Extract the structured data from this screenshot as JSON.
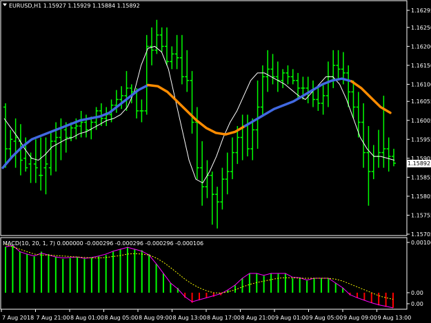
{
  "main": {
    "title": "EURUSD,H1  1.15927 1.15929 1.15884 1.15892",
    "price_ticks": [
      "1.16295",
      "1.16250",
      "1.16200",
      "1.16150",
      "1.16100",
      "1.16055",
      "1.16005",
      "1.15955",
      "1.15905",
      "1.15855",
      "1.15805",
      "1.15755",
      "1.15705"
    ],
    "current_price": "1.15892"
  },
  "macd": {
    "title": "MACD(10, 20, 1, 7) 0.000000 -0.000296 -0.000296 -0.000296 -0.000106",
    "ticks": [
      "0.001068",
      "0.00",
      "0.00"
    ]
  },
  "time_labels": [
    "7 Aug 2018",
    "7 Aug 21:00",
    "8 Aug 01:00",
    "8 Aug 05:00",
    "8 Aug 09:00",
    "8 Aug 13:00",
    "8 Aug 17:00",
    "8 Aug 21:00",
    "9 Aug 01:00",
    "9 Aug 05:00",
    "9 Aug 09:00",
    "9 Aug 13:00"
  ],
  "colors": {
    "bars": "#00ff00",
    "fast_ma": "#ffffff",
    "slow_ma_up": "#4169e1",
    "slow_ma_down": "#ff8c00",
    "macd_hist_up": "#00ff00",
    "macd_hist_dn": "#ff0000",
    "macd_line": "#ff00ff",
    "signal_line": "#ffff00"
  },
  "chart_data": {
    "type": "ohlc",
    "price_range": [
      1.15705,
      1.16315
    ],
    "bars": [
      [
        1.1604,
        1.1605,
        1.1588,
        1.1593
      ],
      [
        1.1593,
        1.1598,
        1.15905,
        1.15955
      ],
      [
        1.1595,
        1.1601,
        1.1588,
        1.1596
      ],
      [
        1.1595,
        1.15995,
        1.1586,
        1.159
      ],
      [
        1.15905,
        1.1596,
        1.1587,
        1.1588
      ],
      [
        1.1589,
        1.1592,
        1.1584,
        1.15905
      ],
      [
        1.1589,
        1.15955,
        1.1584,
        1.1588
      ],
      [
        1.1586,
        1.1596,
        1.1582,
        1.1586
      ],
      [
        1.1588,
        1.1596,
        1.1581,
        1.1589
      ],
      [
        1.1588,
        1.15975,
        1.1586,
        1.1595
      ],
      [
        1.1595,
        1.16,
        1.1587,
        1.1596
      ],
      [
        1.1596,
        1.1601,
        1.159,
        1.15985
      ],
      [
        1.1598,
        1.16,
        1.1592,
        1.1596
      ],
      [
        1.1596,
        1.16,
        1.1595,
        1.15985
      ],
      [
        1.15985,
        1.1601,
        1.15955,
        1.1599
      ],
      [
        1.1599,
        1.1603,
        1.1596,
        1.16
      ],
      [
        1.16,
        1.1602,
        1.1596,
        1.1598
      ],
      [
        1.1598,
        1.16015,
        1.15955,
        1.16
      ],
      [
        1.16,
        1.1604,
        1.1598,
        1.1603
      ],
      [
        1.1603,
        1.1605,
        1.1599,
        1.1601
      ],
      [
        1.1601,
        1.1604,
        1.1599,
        1.1602
      ],
      [
        1.1602,
        1.1606,
        1.16,
        1.16045
      ],
      [
        1.16045,
        1.16085,
        1.16025,
        1.1606
      ],
      [
        1.1606,
        1.16095,
        1.16035,
        1.1607
      ],
      [
        1.1607,
        1.16135,
        1.1603,
        1.1609
      ],
      [
        1.1609,
        1.161,
        1.1605,
        1.1608
      ],
      [
        1.1608,
        1.1609,
        1.1601,
        1.1603
      ],
      [
        1.1603,
        1.1606,
        1.16,
        1.1603
      ],
      [
        1.1603,
        1.1623,
        1.1602,
        1.162
      ],
      [
        1.162,
        1.1625,
        1.1615,
        1.1619
      ],
      [
        1.1619,
        1.1627,
        1.1618,
        1.1623
      ],
      [
        1.1623,
        1.1625,
        1.16185,
        1.162
      ],
      [
        1.162,
        1.1625,
        1.1615,
        1.1616
      ],
      [
        1.1616,
        1.162,
        1.1614,
        1.1618
      ],
      [
        1.1618,
        1.1623,
        1.1614,
        1.1617
      ],
      [
        1.1617,
        1.1623,
        1.161,
        1.1612
      ],
      [
        1.1612,
        1.1619,
        1.1608,
        1.1611
      ],
      [
        1.1611,
        1.16135,
        1.1597,
        1.16
      ],
      [
        1.16,
        1.1604,
        1.1585,
        1.1588
      ],
      [
        1.1588,
        1.1595,
        1.1578,
        1.1583
      ],
      [
        1.1583,
        1.159,
        1.158,
        1.1586
      ],
      [
        1.1586,
        1.1587,
        1.1573,
        1.1581
      ],
      [
        1.1581,
        1.1583,
        1.1572,
        1.1579
      ],
      [
        1.1579,
        1.1588,
        1.1577,
        1.1585
      ],
      [
        1.1585,
        1.1592,
        1.1581,
        1.1587
      ],
      [
        1.1587,
        1.1596,
        1.1585,
        1.1592
      ],
      [
        1.1592,
        1.1599,
        1.1589,
        1.1596
      ],
      [
        1.1596,
        1.1602,
        1.159,
        1.1599
      ],
      [
        1.1599,
        1.1602,
        1.1591,
        1.1593
      ],
      [
        1.1593,
        1.1601,
        1.159,
        1.1598
      ],
      [
        1.1598,
        1.1611,
        1.1593,
        1.1604
      ],
      [
        1.1604,
        1.1615,
        1.1602,
        1.1612
      ],
      [
        1.1612,
        1.1619,
        1.1608,
        1.1614
      ],
      [
        1.1614,
        1.1618,
        1.161,
        1.1612
      ],
      [
        1.1612,
        1.1616,
        1.1608,
        1.1611
      ],
      [
        1.1611,
        1.1614,
        1.1609,
        1.1613
      ],
      [
        1.1613,
        1.1615,
        1.161,
        1.1612
      ],
      [
        1.1612,
        1.1614,
        1.161,
        1.1611
      ],
      [
        1.1611,
        1.1613,
        1.1606,
        1.1609
      ],
      [
        1.1609,
        1.1612,
        1.1606,
        1.1609
      ],
      [
        1.1609,
        1.1612,
        1.1605,
        1.1608
      ],
      [
        1.1608,
        1.1611,
        1.1604,
        1.1606
      ],
      [
        1.1606,
        1.1609,
        1.1603,
        1.1605
      ],
      [
        1.1605,
        1.161,
        1.1602,
        1.1607
      ],
      [
        1.1607,
        1.1616,
        1.1604,
        1.1612
      ],
      [
        1.1612,
        1.1619,
        1.1609,
        1.1615
      ],
      [
        1.1615,
        1.1619,
        1.1611,
        1.1614
      ],
      [
        1.1614,
        1.16185,
        1.161,
        1.1613
      ],
      [
        1.1613,
        1.1615,
        1.1604,
        1.1608
      ],
      [
        1.1608,
        1.1611,
        1.1601,
        1.1604
      ],
      [
        1.1604,
        1.1608,
        1.1596,
        1.16
      ],
      [
        1.16,
        1.1605,
        1.1588,
        1.1592
      ],
      [
        1.1592,
        1.1599,
        1.1578,
        1.1587
      ],
      [
        1.1587,
        1.1594,
        1.1585,
        1.1591
      ],
      [
        1.1591,
        1.1598,
        1.1588,
        1.1592
      ],
      [
        1.1592,
        1.1607,
        1.1588,
        1.1593
      ],
      [
        1.1593,
        1.1596,
        1.1587,
        1.1591
      ],
      [
        1.1591,
        1.1593,
        1.15884,
        1.15892
      ]
    ],
    "fast_ma": [
      1.1601,
      1.15985,
      1.1596,
      1.1593,
      1.15905,
      1.159,
      1.15915,
      1.15935,
      1.15945,
      1.15955,
      1.1596,
      1.1597,
      1.15975,
      1.15985,
      1.15995,
      1.16005,
      1.1601,
      1.1602,
      1.1604,
      1.1608,
      1.1615,
      1.16195,
      1.162,
      1.16185,
      1.1614,
      1.1606,
      1.1598,
      1.159,
      1.1585,
      1.1584,
      1.1587,
      1.1591,
      1.1596,
      1.16,
      1.1603,
      1.1607,
      1.1611,
      1.1613,
      1.1613,
      1.1612,
      1.1611,
      1.161,
      1.16085,
      1.1607,
      1.1606,
      1.1608,
      1.161,
      1.1612,
      1.1612,
      1.161,
      1.1606,
      1.1601,
      1.1596,
      1.1593,
      1.1591,
      1.1591,
      1.15905,
      1.159
    ],
    "slow_ma": [
      1.1588,
      1.1591,
      1.15935,
      1.15955,
      1.15965,
      1.15975,
      1.15985,
      1.15995,
      1.16005,
      1.1601,
      1.16015,
      1.16025,
      1.16045,
      1.16065,
      1.16085,
      1.16098,
      1.16095,
      1.1608,
      1.16055,
      1.1603,
      1.16005,
      1.15985,
      1.15972,
      1.15968,
      1.15975,
      1.1599,
      1.16005,
      1.1602,
      1.16035,
      1.16045,
      1.16055,
      1.1607,
      1.16085,
      1.161,
      1.1611,
      1.16115,
      1.16108,
      1.1609,
      1.16065,
      1.1604,
      1.16025
    ],
    "slow_ma_turns": [
      15,
      25,
      36
    ],
    "macd_range": [
      -0.0003,
      0.00107
    ],
    "macd_hist": [
      0.00095,
      0.001,
      0.00085,
      0.0008,
      0.00075,
      0.00085,
      0.0008,
      0.00075,
      0.0007,
      0.00072,
      0.00074,
      0.0007,
      0.00072,
      0.00075,
      0.00078,
      0.00085,
      0.0009,
      0.00095,
      0.0009,
      0.00088,
      0.0008,
      0.0006,
      0.0004,
      0.0002,
      0.0001,
      -0.0001,
      -0.0002,
      -0.00015,
      -0.0001,
      -8e-05,
      -5e-05,
      5e-05,
      0.00015,
      0.0003,
      0.0004,
      0.0004,
      0.00035,
      0.0004,
      0.0004,
      0.0004,
      0.0003,
      0.0003,
      0.00025,
      0.0003,
      0.0003,
      0.0003,
      0.0002,
      0.0001,
      -5e-05,
      -0.0001,
      -0.00015,
      -0.0002,
      -0.00025,
      -0.00028,
      -0.0003
    ],
    "macd_line": [
      0.00095,
      0.00098,
      0.00085,
      0.0008,
      0.00076,
      0.00082,
      0.00078,
      0.00074,
      0.00072,
      0.00073,
      0.00074,
      0.00071,
      0.00073,
      0.00076,
      0.0008,
      0.00086,
      0.0009,
      0.00094,
      0.0009,
      0.00086,
      0.00078,
      0.0006,
      0.0004,
      0.0002,
      8e-05,
      -8e-05,
      -0.00018,
      -0.00014,
      -0.0001,
      -6e-05,
      -2e-05,
      6e-05,
      0.00016,
      0.0003,
      0.0004,
      0.0004,
      0.00036,
      0.0004,
      0.0004,
      0.0004,
      0.00032,
      0.00031,
      0.00026,
      0.0003,
      0.0003,
      0.0003,
      0.0002,
      0.0001,
      -4e-05,
      -0.0001,
      -0.00015,
      -0.0002,
      -0.00024,
      -0.00027,
      -0.0003
    ],
    "signal_line": [
      0.001,
      0.00095,
      0.0009,
      0.00085,
      0.0008,
      0.00078,
      0.00078,
      0.00077,
      0.00076,
      0.00075,
      0.00074,
      0.00073,
      0.00072,
      0.00072,
      0.00073,
      0.00075,
      0.00077,
      0.0008,
      0.00081,
      0.0008,
      0.00078,
      0.00072,
      0.00063,
      0.00052,
      0.0004,
      0.00028,
      0.00018,
      0.0001,
      4e-05,
      0.0,
      -1e-05,
      2e-05,
      6e-05,
      0.00012,
      0.00017,
      0.00021,
      0.00024,
      0.00027,
      0.0003,
      0.00031,
      0.00031,
      0.0003,
      0.0003,
      0.0003,
      0.0003,
      0.0003,
      0.00028,
      0.00024,
      0.00018,
      0.00012,
      6e-05,
      0.0,
      -6e-05,
      -0.0001,
      -0.00013
    ]
  }
}
